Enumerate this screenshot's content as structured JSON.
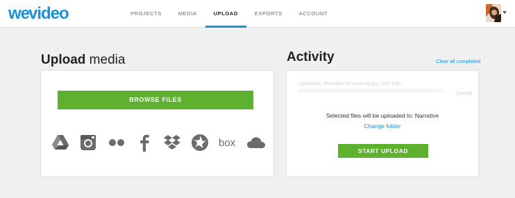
{
  "brand": {
    "name": "WeVideo",
    "accent": "#1a90d6",
    "green": "#5db12f"
  },
  "nav": {
    "items": [
      {
        "label": "PROJECTS",
        "active": false
      },
      {
        "label": "MEDIA",
        "active": false
      },
      {
        "label": "UPLOAD",
        "active": true
      },
      {
        "label": "EXPORTS",
        "active": false
      },
      {
        "label": "ACCOUNT",
        "active": false
      }
    ]
  },
  "upload": {
    "title_bold": "Upload",
    "title_rest": "media",
    "browse_label": "BROWSE FILES",
    "services": [
      "google-drive",
      "instagram",
      "flickr",
      "facebook",
      "dropbox",
      "picasa",
      "box",
      "onedrive"
    ]
  },
  "activity": {
    "title": "Activity",
    "clear_label": "Clear all completed",
    "faded_file": "Uploading WeVideo for Android.jpg (247 KB)",
    "faded_cancel": "Cancel",
    "destination_text": "Selected files will be uploaded to: Narrative",
    "change_folder_label": "Change folder",
    "start_label": "START UPLOAD"
  }
}
